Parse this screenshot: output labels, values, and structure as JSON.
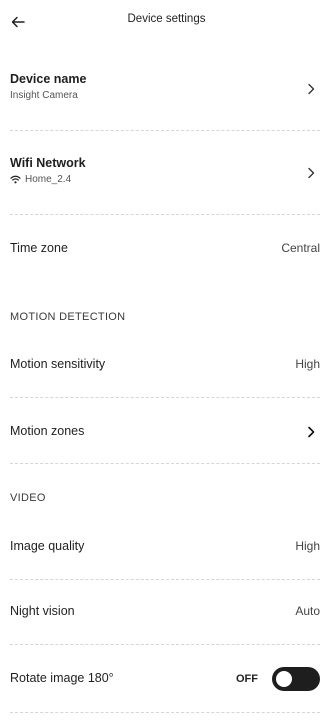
{
  "header": {
    "title": "Device settings",
    "back_icon": "arrow-left-icon"
  },
  "device_name": {
    "label": "Device name",
    "value": "Insight Camera"
  },
  "wifi": {
    "label": "Wifi Network",
    "value": "Home_2.4",
    "icon": "wifi-icon"
  },
  "time_zone": {
    "label": "Time zone",
    "value": "Central"
  },
  "motion_section": {
    "title": "MOTION DETECTION",
    "sensitivity_label": "Motion sensitivity",
    "sensitivity_value": "High",
    "zones_label": "Motion zones"
  },
  "video_section": {
    "title": "VIDEO",
    "quality_label": "Image quality",
    "quality_value": "High",
    "night_label": "Night vision",
    "night_value": "Auto",
    "rotate_label": "Rotate image 180°",
    "rotate_state": "OFF"
  }
}
